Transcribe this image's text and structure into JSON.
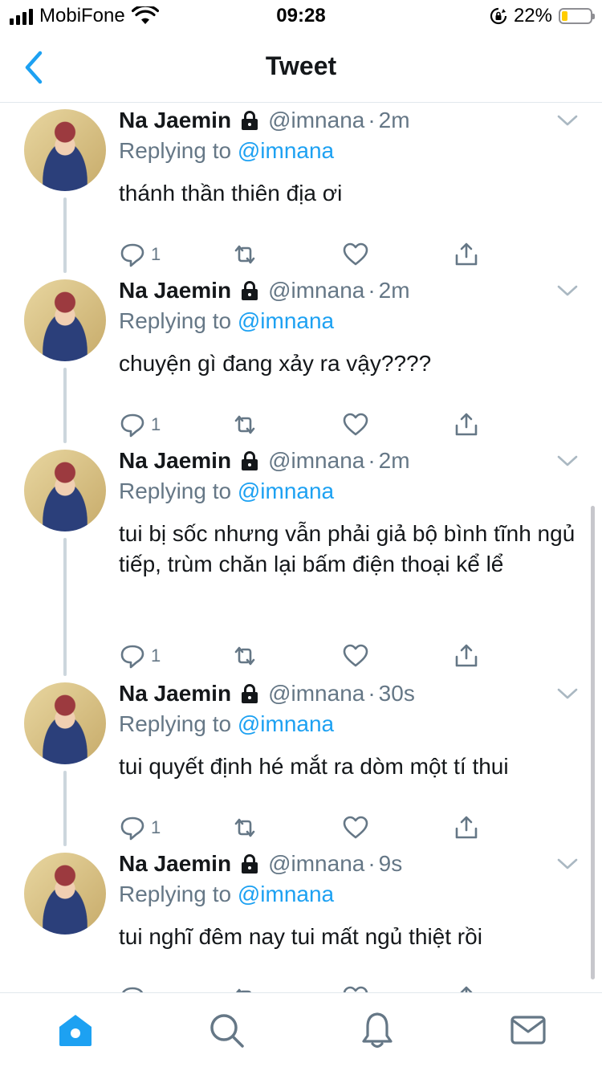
{
  "status_bar": {
    "carrier": "MobiFone",
    "time": "09:28",
    "battery_percent": "22%",
    "battery_level": 0.22,
    "battery_color": "#ffcc00"
  },
  "nav": {
    "title": "Tweet",
    "back_icon": "chevron-left-icon",
    "accent": "#1da1f2"
  },
  "tweets": [
    {
      "name": "Na Jaemin",
      "handle": "@imnana",
      "separator": "·",
      "time": "2m",
      "replying_prefix": "Replying to",
      "replying_to": "@imnana",
      "text": "thánh thần thiên địa ơi",
      "reply_count": "1"
    },
    {
      "name": "Na Jaemin",
      "handle": "@imnana",
      "separator": "·",
      "time": "2m",
      "replying_prefix": "Replying to",
      "replying_to": "@imnana",
      "text": "chuyện gì đang xảy ra vậy????",
      "reply_count": "1"
    },
    {
      "name": "Na Jaemin",
      "handle": "@imnana",
      "separator": "·",
      "time": "2m",
      "replying_prefix": "Replying to",
      "replying_to": "@imnana",
      "text": "tui bị sốc nhưng vẫn phải giả bộ bình tĩnh ngủ tiếp, trùm chăn lại bấm điện thoại kể lể",
      "reply_count": "1"
    },
    {
      "name": "Na Jaemin",
      "handle": "@imnana",
      "separator": "·",
      "time": "30s",
      "replying_prefix": "Replying to",
      "replying_to": "@imnana",
      "text": "tui quyết định hé mắt ra dòm một tí thui",
      "reply_count": "1"
    },
    {
      "name": "Na Jaemin",
      "handle": "@imnana",
      "separator": "·",
      "time": "9s",
      "replying_prefix": "Replying to",
      "replying_to": "@imnana",
      "text": "tui nghĩ đêm nay tui mất ngủ thiệt rồi",
      "reply_count": ""
    }
  ],
  "tab_bar": {
    "tabs": [
      "home-icon",
      "search-icon",
      "notifications-bell-icon",
      "messages-envelope-icon"
    ],
    "active": "home-icon"
  }
}
